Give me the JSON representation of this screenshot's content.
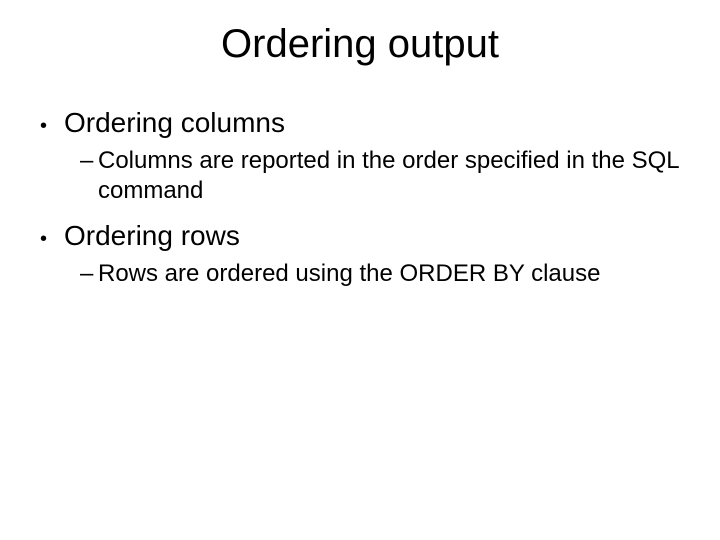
{
  "title": "Ordering output",
  "bullets": [
    {
      "text": "Ordering columns",
      "sub": [
        "Columns are reported in the order specified in the SQL command"
      ]
    },
    {
      "text": "Ordering rows",
      "sub": [
        "Rows are ordered using the ORDER BY clause"
      ]
    }
  ]
}
